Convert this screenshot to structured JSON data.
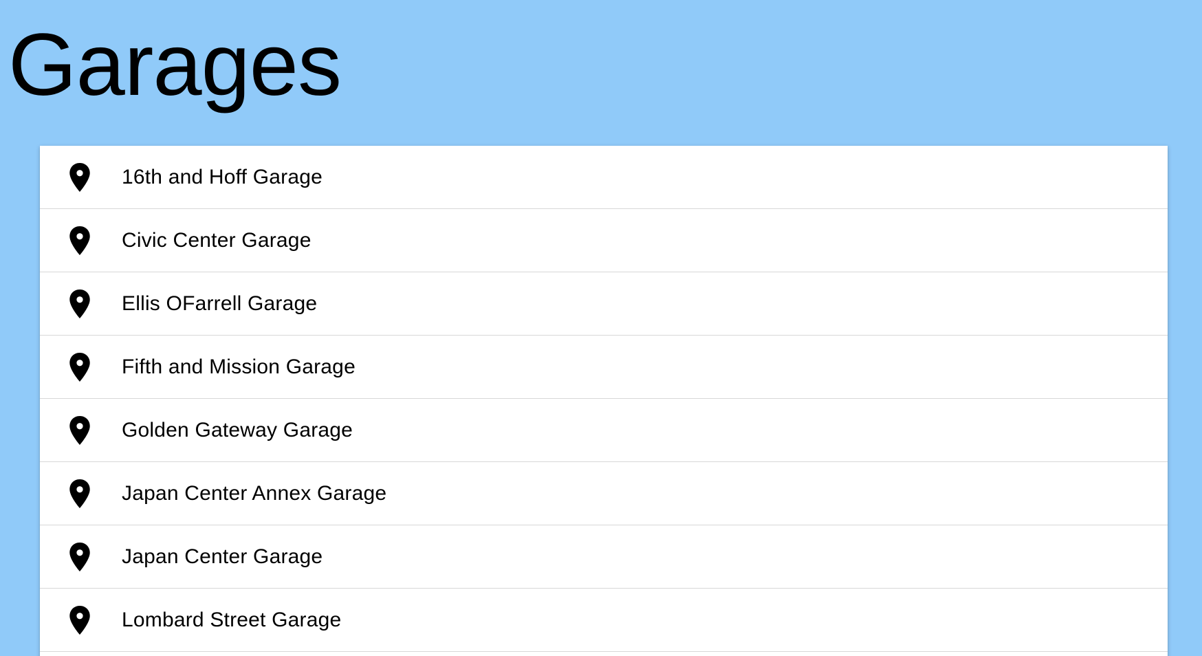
{
  "header": {
    "title": "Garages"
  },
  "garages": {
    "icon": "location-pin-icon",
    "items": [
      {
        "label": "16th and Hoff Garage"
      },
      {
        "label": "Civic Center Garage"
      },
      {
        "label": "Ellis OFarrell Garage"
      },
      {
        "label": "Fifth and Mission Garage"
      },
      {
        "label": "Golden Gateway Garage"
      },
      {
        "label": "Japan Center Annex Garage"
      },
      {
        "label": "Japan Center Garage"
      },
      {
        "label": "Lombard Street Garage"
      }
    ]
  },
  "colors": {
    "background": "#90CAF9",
    "card": "#FFFFFF",
    "text": "#000000",
    "divider": "#D7D7D7"
  }
}
